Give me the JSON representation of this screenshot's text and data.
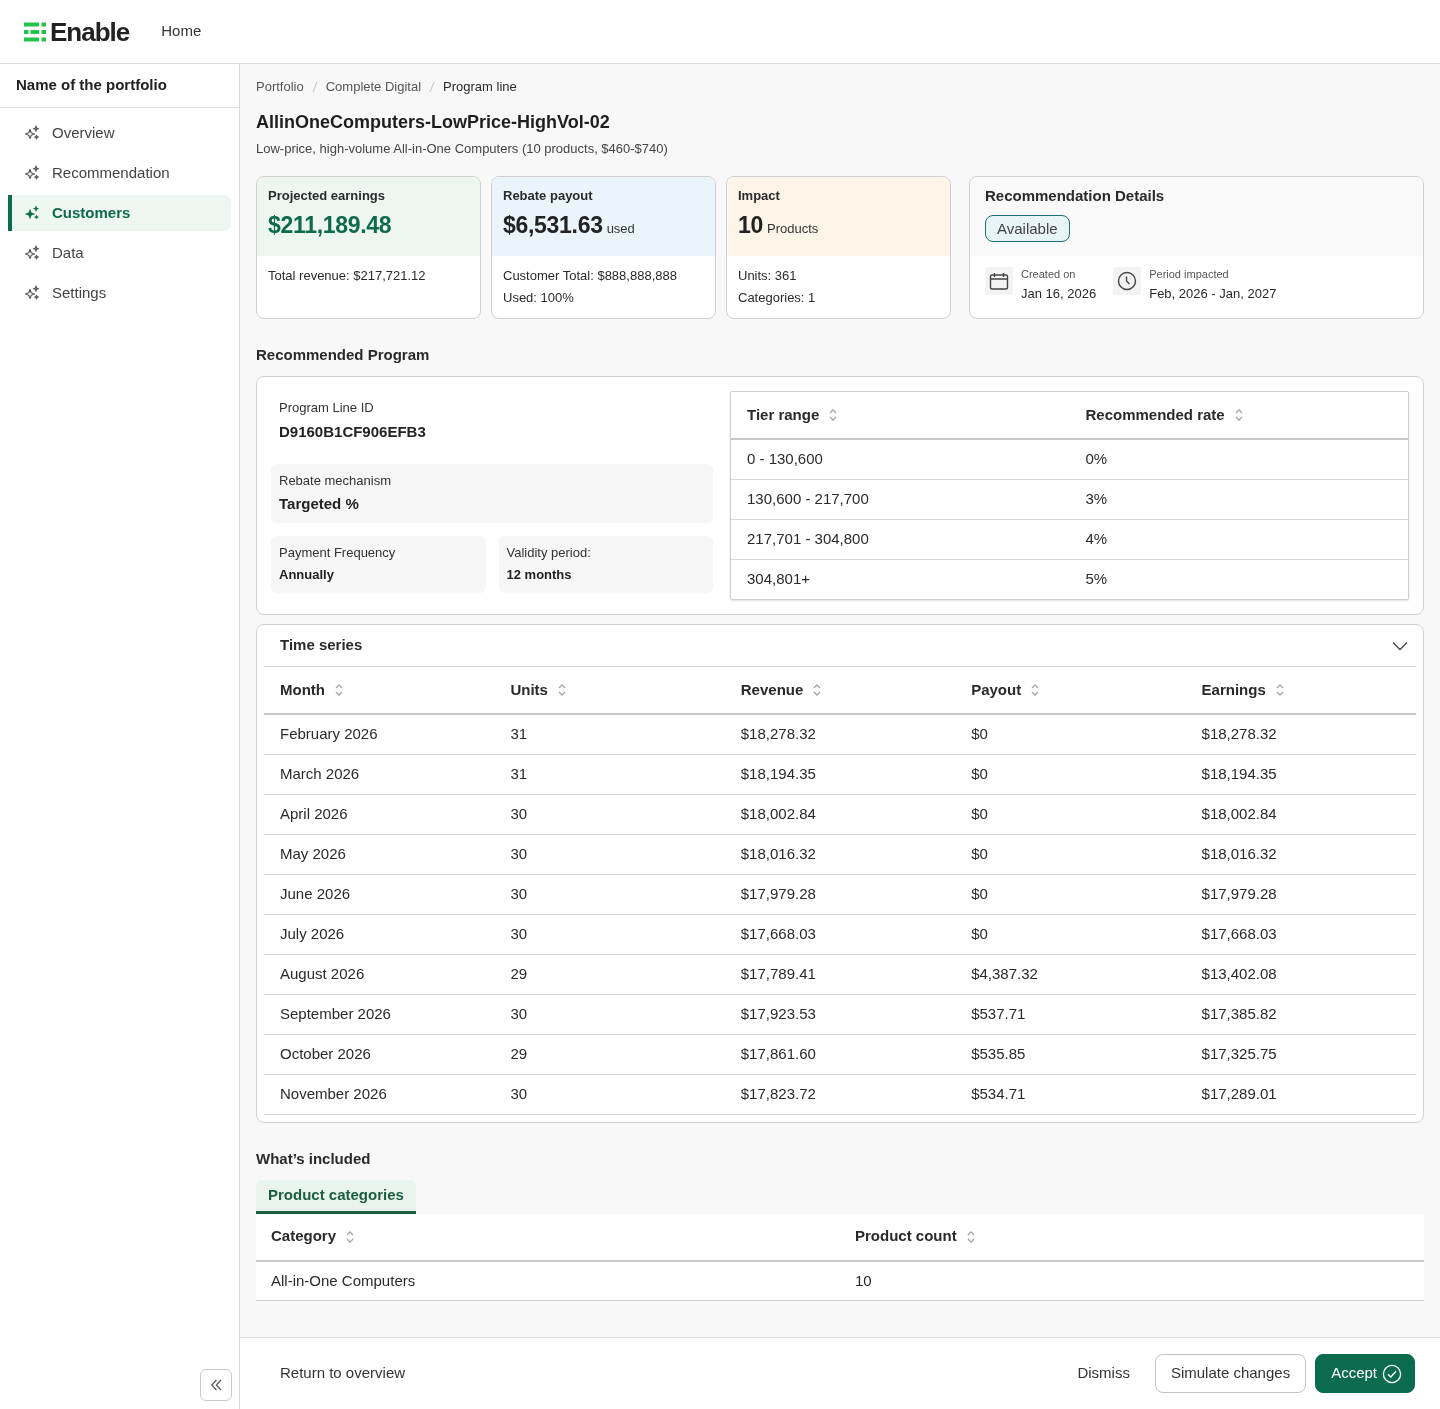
{
  "header": {
    "brand": "Enable",
    "nav": [
      {
        "label": "Home"
      }
    ]
  },
  "sidebar": {
    "title": "Name of the portfolio",
    "items": [
      {
        "label": "Overview",
        "selected": false
      },
      {
        "label": "Recommendation",
        "selected": false
      },
      {
        "label": "Customers",
        "selected": true
      },
      {
        "label": "Data",
        "selected": false
      },
      {
        "label": "Settings",
        "selected": false
      }
    ]
  },
  "breadcrumb": [
    "Portfolio",
    "Complete Digital",
    "Program line"
  ],
  "page_title": "AllinOneComputers-LowPrice-HighVol-02",
  "subtitle": "Low-price, high-volume All-in-One Computers (10 products, $460-$740)",
  "summary_cards": [
    {
      "kind": "earnings",
      "label": "Projected earnings",
      "value": "$211,189.48",
      "details": [
        "Total revenue: $217,721.12"
      ]
    },
    {
      "kind": "payout",
      "label": "Rebate payout",
      "value": "$6,531.63",
      "unit": "used",
      "details": [
        "Customer Total: $888,888,888",
        "Used: 100%"
      ]
    },
    {
      "kind": "impact",
      "label": "Impact",
      "value": "10",
      "unit": "Products",
      "details": [
        "Units: 361",
        "Categories: 1"
      ]
    }
  ],
  "recommendation_details": {
    "title": "Recommendation Details",
    "status": "Available",
    "facts": [
      {
        "kind": "date",
        "label": "Created on",
        "value": "Jan 16, 2026"
      },
      {
        "kind": "period",
        "label": "Period impacted",
        "value": "Feb, 2026 - Jan, 2027"
      }
    ]
  },
  "recommended_program": {
    "heading": "Recommended Program",
    "fields": [
      {
        "kind": "plain",
        "label": "Program Line ID",
        "value": "D9160B1CF906EFB3"
      },
      {
        "kind": "wide",
        "label": "Rebate mechanism",
        "value": "Targeted %"
      },
      {
        "kind": "half",
        "label": "Payment Frequency",
        "value": "Annually"
      },
      {
        "kind": "half",
        "label": "Validity period:",
        "value": "12 months"
      }
    ],
    "tiers": {
      "columns": [
        "Tier range",
        "Recommended rate"
      ],
      "rows": [
        [
          "0 - 130,600",
          "0%"
        ],
        [
          "130,600 - 217,700",
          "3%"
        ],
        [
          "217,701 - 304,800",
          "4%"
        ],
        [
          "304,801+",
          "5%"
        ]
      ]
    }
  },
  "time_series": {
    "title": "Time series",
    "expanded": true,
    "columns": [
      "Month",
      "Units",
      "Revenue",
      "Payout",
      "Earnings"
    ],
    "rows": [
      [
        "February 2026",
        "31",
        "$18,278.32",
        "$0",
        "$18,278.32"
      ],
      [
        "March 2026",
        "31",
        "$18,194.35",
        "$0",
        "$18,194.35"
      ],
      [
        "April 2026",
        "30",
        "$18,002.84",
        "$0",
        "$18,002.84"
      ],
      [
        "May 2026",
        "30",
        "$18,016.32",
        "$0",
        "$18,016.32"
      ],
      [
        "June 2026",
        "30",
        "$17,979.28",
        "$0",
        "$17,979.28"
      ],
      [
        "July 2026",
        "30",
        "$17,668.03",
        "$0",
        "$17,668.03"
      ],
      [
        "August 2026",
        "29",
        "$17,789.41",
        "$4,387.32",
        "$13,402.08"
      ],
      [
        "September 2026",
        "30",
        "$17,923.53",
        "$537.71",
        "$17,385.82"
      ],
      [
        "October 2026",
        "29",
        "$17,861.60",
        "$535.85",
        "$17,325.75"
      ],
      [
        "November 2026",
        "30",
        "$17,823.72",
        "$534.71",
        "$17,289.01"
      ]
    ]
  },
  "whats_included": {
    "heading": "What’s included",
    "tabs": [
      {
        "label": "Product categories",
        "selected": true
      }
    ],
    "columns": [
      "Category",
      "Product count"
    ],
    "rows": [
      [
        "All-in-One Computers",
        "10"
      ]
    ]
  },
  "footer": {
    "link": "Return to overview",
    "actions": [
      {
        "kind": "text",
        "label": "Dismiss"
      },
      {
        "kind": "outline",
        "label": "Simulate changes"
      },
      {
        "kind": "primary",
        "label": "Accept"
      }
    ]
  }
}
